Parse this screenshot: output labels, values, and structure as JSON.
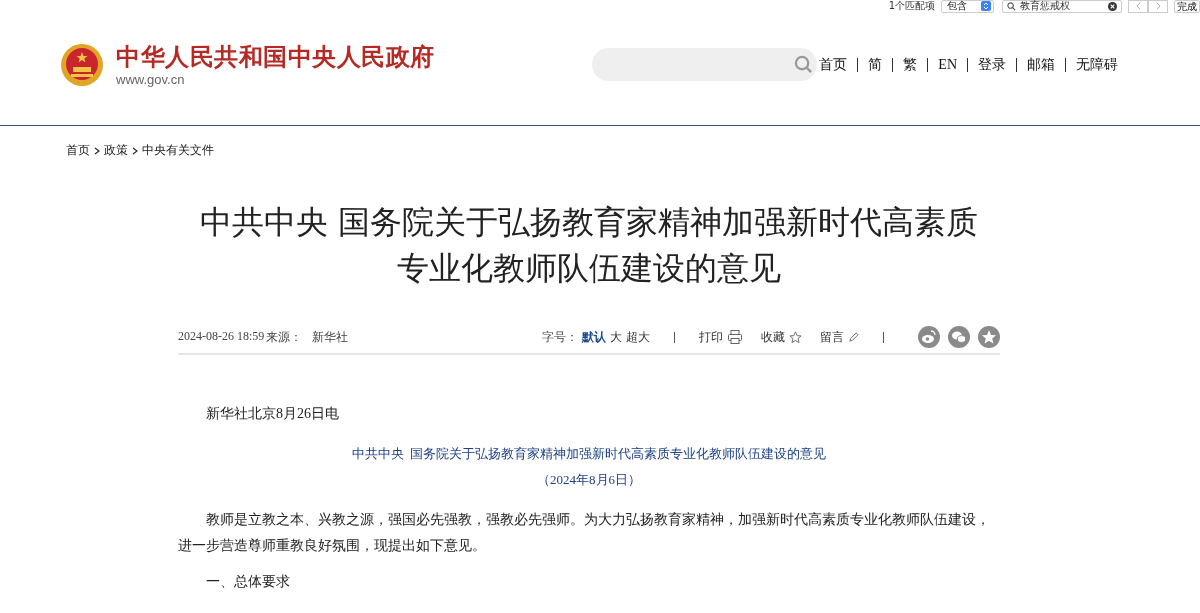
{
  "find_bar": {
    "match_count": "1个匹配项",
    "mode": "包含",
    "query": "教育惩戒权",
    "done": "完成"
  },
  "header": {
    "site_name": "中华人民共和国中央人民政府",
    "site_url": "www.gov.cn",
    "nav": [
      "首页",
      "简",
      "繁",
      "EN",
      "登录",
      "邮箱",
      "无障碍"
    ]
  },
  "breadcrumb": [
    "首页",
    "政策",
    "中央有关文件"
  ],
  "article": {
    "title_lines": [
      "中共中央 国务院关于弘扬教育家精神加强新时代高素质",
      "专业化教师队伍建设的意见"
    ],
    "date": "2024-08-26 18:59",
    "source_label": "来源：",
    "source": "新华社",
    "font_size_label": "字号：",
    "font_sizes": [
      {
        "label": "默认",
        "selected": true
      },
      {
        "label": "大",
        "selected": false
      },
      {
        "label": "超大",
        "selected": false
      }
    ],
    "print": "打印",
    "favorite": "收藏",
    "comment": "留言",
    "dateline": "新华社北京8月26日电",
    "doc_title": "中共中央  国务院关于弘扬教育家精神加强新时代高素质专业化教师队伍建设的意见",
    "doc_date": "（2024年8月6日）",
    "paragraph": "教师是立教之本、兴教之源，强国必先强教，强教必先强师。为大力弘扬教育家精神，加强新时代高素质专业化教师队伍建设，进一步营造尊师重教良好氛围，现提出如下意见。",
    "section_heading": "一、总体要求"
  }
}
